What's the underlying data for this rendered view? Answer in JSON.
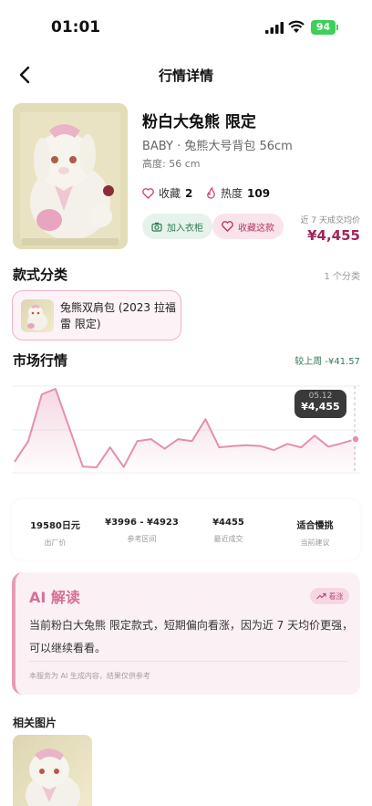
{
  "status_bar": {
    "time": "01:01",
    "battery": "94"
  },
  "nav": {
    "title": "行情详情"
  },
  "product": {
    "title": "粉白大兔熊 限定",
    "subtitle": "BABY · 兔熊大号背包 56cm",
    "height": "高度: 56 cm",
    "favorites_label": "收藏",
    "favorites_count": "2",
    "heat_label": "热度",
    "heat_count": "109",
    "add_wardrobe_label": "加入衣柜",
    "favorite_style_label": "收藏这款",
    "avg_price_label": "近 7 天成交均价",
    "avg_price": "¥4,455"
  },
  "styles": {
    "title": "款式分类",
    "count": "1 个分类",
    "items": [
      {
        "name": "兔熊双肩包 (2023 拉福雷 限定)"
      }
    ]
  },
  "market": {
    "title": "市场行情",
    "change": "较上周 -¥41.57",
    "tooltip_date": "05.12",
    "tooltip_value": "¥4,455"
  },
  "chart_data": {
    "type": "area",
    "title": "",
    "x": [
      1,
      2,
      3,
      4,
      5,
      6,
      7,
      8,
      9,
      10,
      11,
      12,
      13,
      14,
      15,
      16,
      17,
      18,
      19,
      20,
      21,
      22,
      23,
      24,
      25,
      26
    ],
    "values": [
      4030,
      4180,
      4520,
      4560,
      4280,
      3996,
      3990,
      4135,
      3993,
      4180,
      4195,
      4125,
      4195,
      4180,
      4340,
      4135,
      4145,
      4150,
      4145,
      4115,
      4160,
      4135,
      4220,
      4140,
      4165,
      4195
    ],
    "ylim": [
      3950,
      4580
    ],
    "color": "#e48fb0",
    "highlight": {
      "date": "05.12",
      "value": 4455
    }
  },
  "summary": [
    {
      "value": "19580日元",
      "label": "出厂价"
    },
    {
      "value": "¥3996 - ¥4923",
      "label": "参考区间"
    },
    {
      "value": "¥4455",
      "label": "最近成交"
    },
    {
      "value": "适合慢挑",
      "label": "当前建议"
    }
  ],
  "ai": {
    "title": "AI 解读",
    "tag": "看涨",
    "text": "当前粉白大兔熊 限定款式，短期偏向看涨，因为近 7 天均价更强，可以继续看看。",
    "note": "本服务为 AI 生成内容，结果仅供参考"
  },
  "related": {
    "title": "相关图片"
  },
  "colors": {
    "accent": "#a3245a",
    "pink": "#e48fb0",
    "green": "#2f7a55",
    "change": "#2f7a55"
  }
}
